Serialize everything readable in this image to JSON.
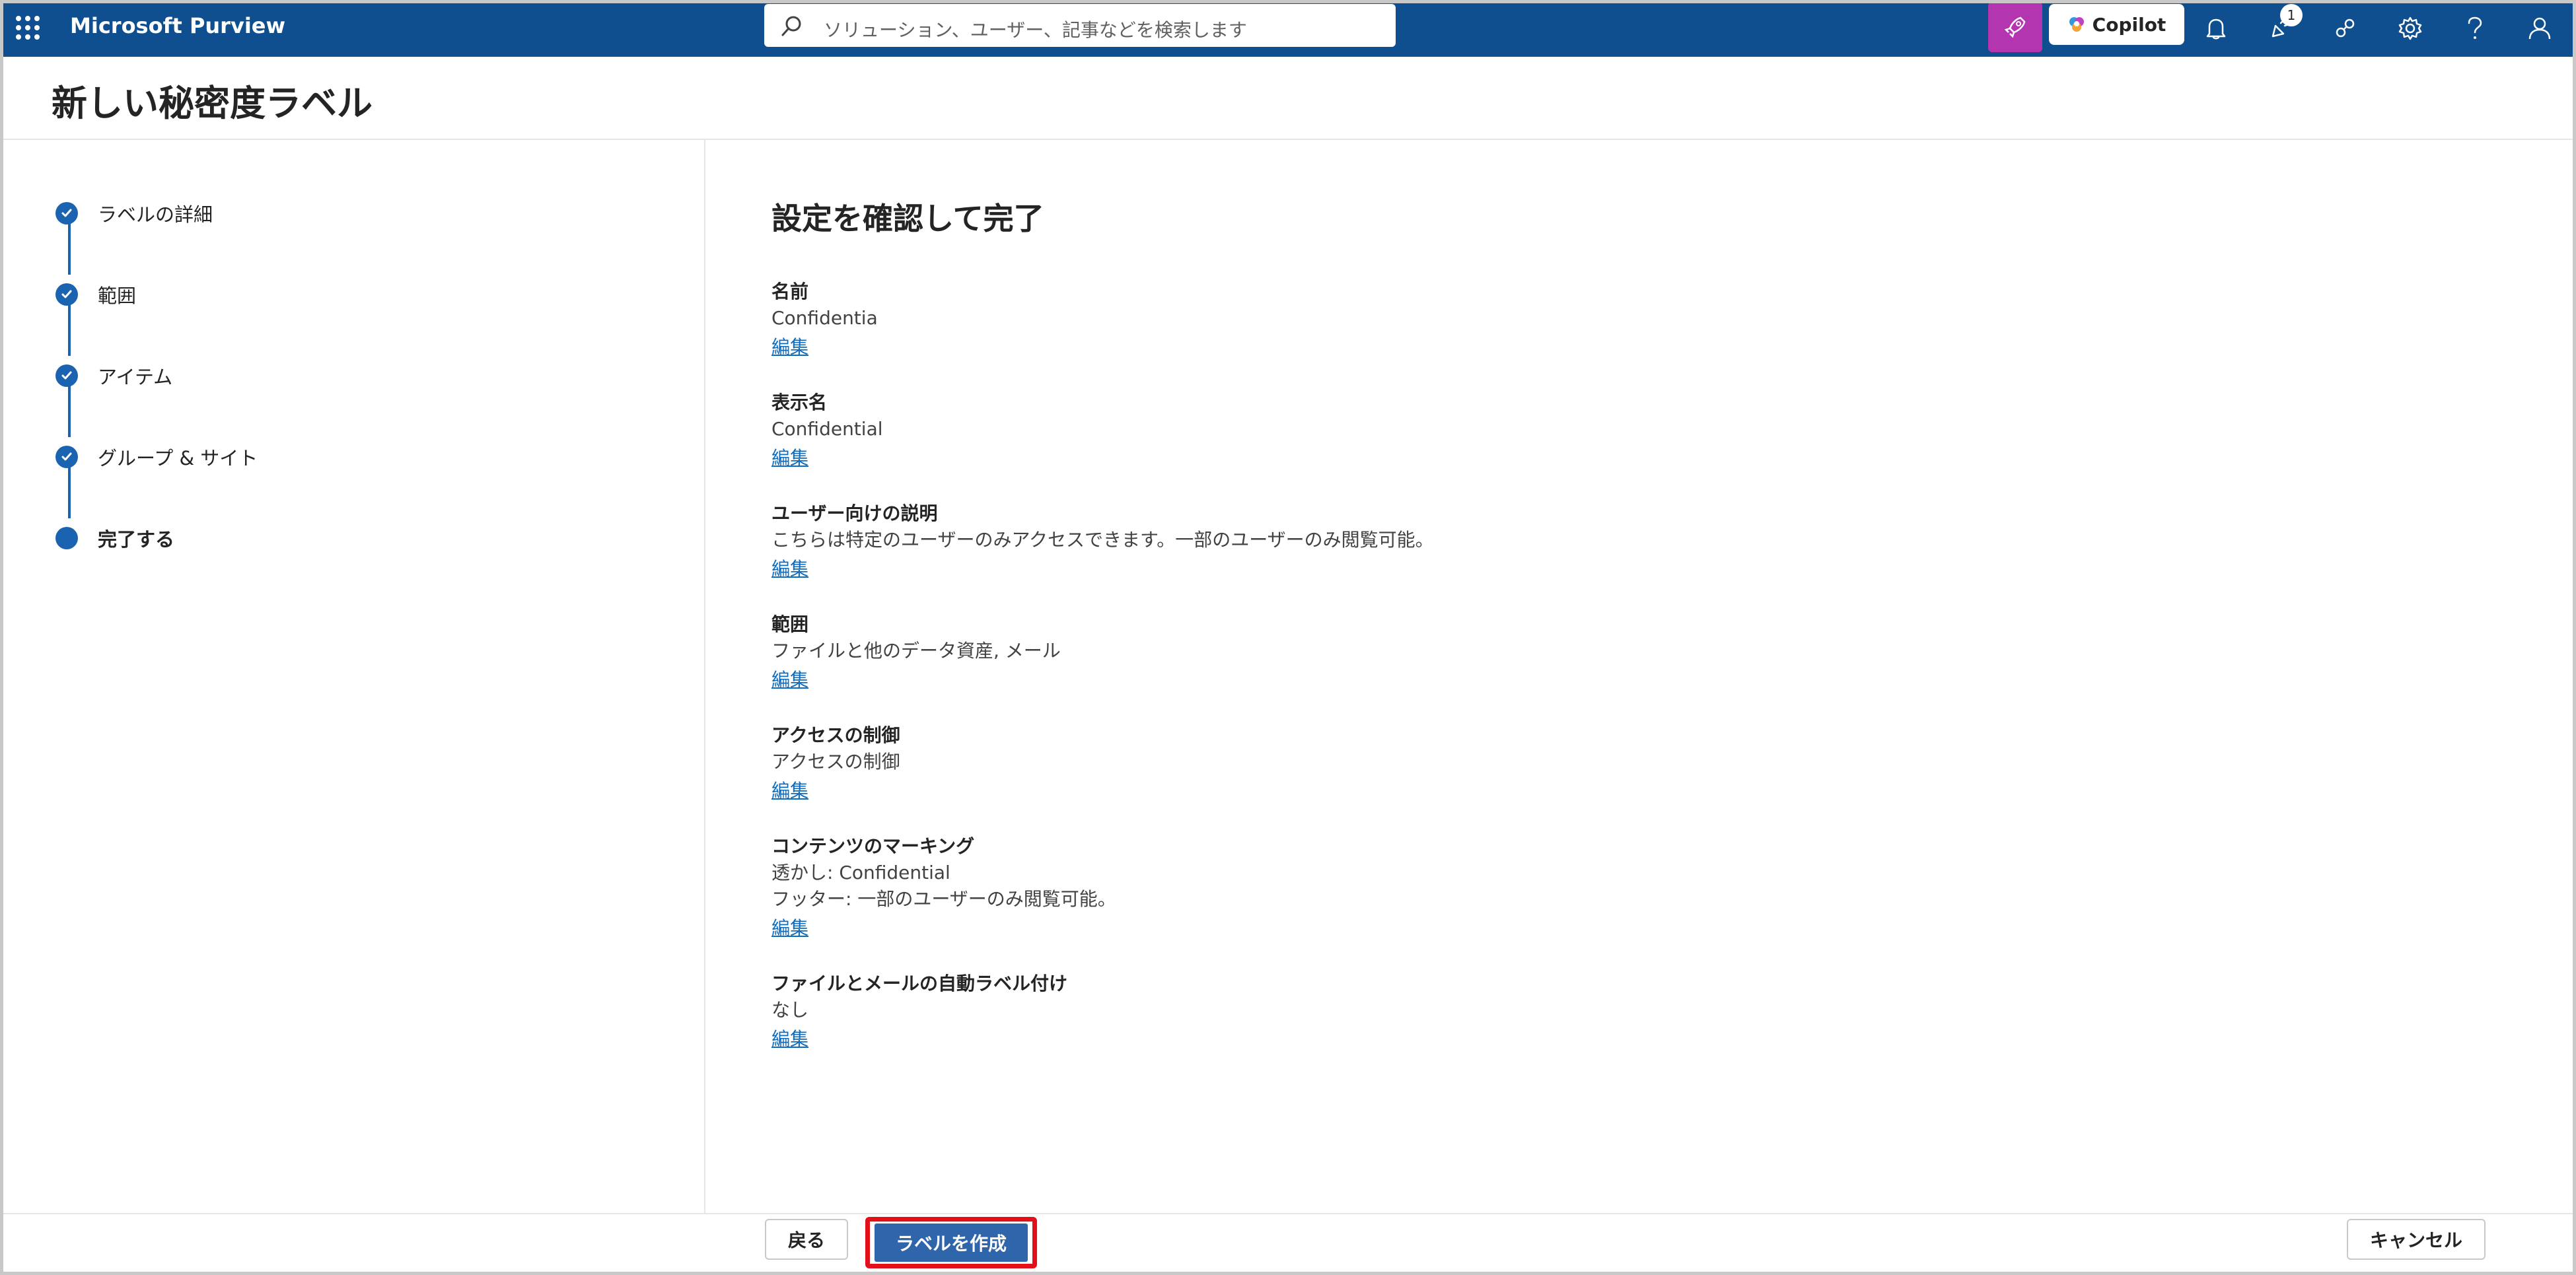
{
  "app": {
    "title": "Microsoft Purview",
    "search_placeholder": "ソリューション、ユーザー、記事などを検索します",
    "copilot_label": "Copilot",
    "notification_badge": "1",
    "accent_color": "#0f4f8f",
    "icons": [
      "waffle-icon",
      "search-icon",
      "rocket-icon",
      "copilot-icon",
      "bell-icon",
      "whats-new-icon",
      "share-icon",
      "settings-icon",
      "help-icon",
      "account-icon"
    ]
  },
  "page": {
    "title": "新しい秘密度ラベル"
  },
  "steps": [
    {
      "label": "ラベルの詳細",
      "status": "completed"
    },
    {
      "label": "範囲",
      "status": "completed"
    },
    {
      "label": "アイテム",
      "status": "completed"
    },
    {
      "label": "グループ & サイト",
      "status": "completed"
    },
    {
      "label": "完了する",
      "status": "current"
    }
  ],
  "review": {
    "title": "設定を確認して完了",
    "edit_label": "編集",
    "fields": [
      {
        "label": "名前",
        "values": [
          "Confidentia"
        ]
      },
      {
        "label": "表示名",
        "values": [
          "Confidential"
        ]
      },
      {
        "label": "ユーザー向けの説明",
        "values": [
          "こちらは特定のユーザーのみアクセスできます。一部のユーザーのみ閲覧可能。"
        ]
      },
      {
        "label": "範囲",
        "values": [
          "ファイルと他のデータ資産, メール"
        ]
      },
      {
        "label": "アクセスの制御",
        "values": [
          "アクセスの制御"
        ]
      },
      {
        "label": "コンテンツのマーキング",
        "values": [
          "透かし: Confidential",
          "フッター: 一部のユーザーのみ閲覧可能。"
        ]
      },
      {
        "label": "ファイルとメールの自動ラベル付け",
        "values": [
          "なし"
        ]
      }
    ]
  },
  "footer": {
    "back_label": "戻る",
    "create_label": "ラベルを作成",
    "cancel_label": "キャンセル",
    "highlight_color": "#e3101a"
  }
}
